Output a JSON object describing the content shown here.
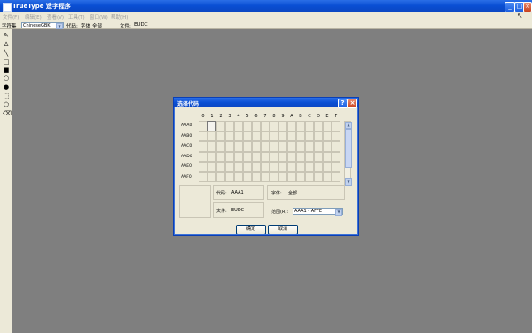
{
  "window": {
    "title": "TrueType 造字程序",
    "menu": [
      "文件(F)",
      "编辑(E)",
      "查看(V)",
      "工具(T)",
      "窗口(W)",
      "帮助(H)"
    ]
  },
  "toolbar": {
    "charset_label": "字符集",
    "charset_value": "ChineseGBK",
    "code_label": "代码:",
    "font_label": "字体",
    "font_value": "全部",
    "file_label": "文件:",
    "file_value": "EUDC"
  },
  "palette": {
    "tools": [
      "pencil-icon",
      "brush-icon",
      "line-icon",
      "hollow-rect-icon",
      "filled-rect-icon",
      "hollow-ellipse-icon",
      "filled-ellipse-icon",
      "select-rect-icon",
      "freeform-select-icon",
      "eraser-icon"
    ]
  },
  "dialog": {
    "title": "选择代码",
    "columns": [
      "0",
      "1",
      "2",
      "3",
      "4",
      "5",
      "6",
      "7",
      "8",
      "9",
      "A",
      "B",
      "C",
      "D",
      "E",
      "F"
    ],
    "rows": [
      "AAA0",
      "AAB0",
      "AAC0",
      "AAD0",
      "AAE0",
      "AAF0"
    ],
    "selected_cell": "AAA1",
    "code_label": "代码:",
    "code_value": "AAA1",
    "font_label": "字体:",
    "font_value": "全部",
    "file_label": "文件:",
    "file_value": "EUDC",
    "range_label": "范围(R):",
    "range_value": "AAA1 - AFFE",
    "ok_label": "确定",
    "cancel_label": "取消"
  }
}
